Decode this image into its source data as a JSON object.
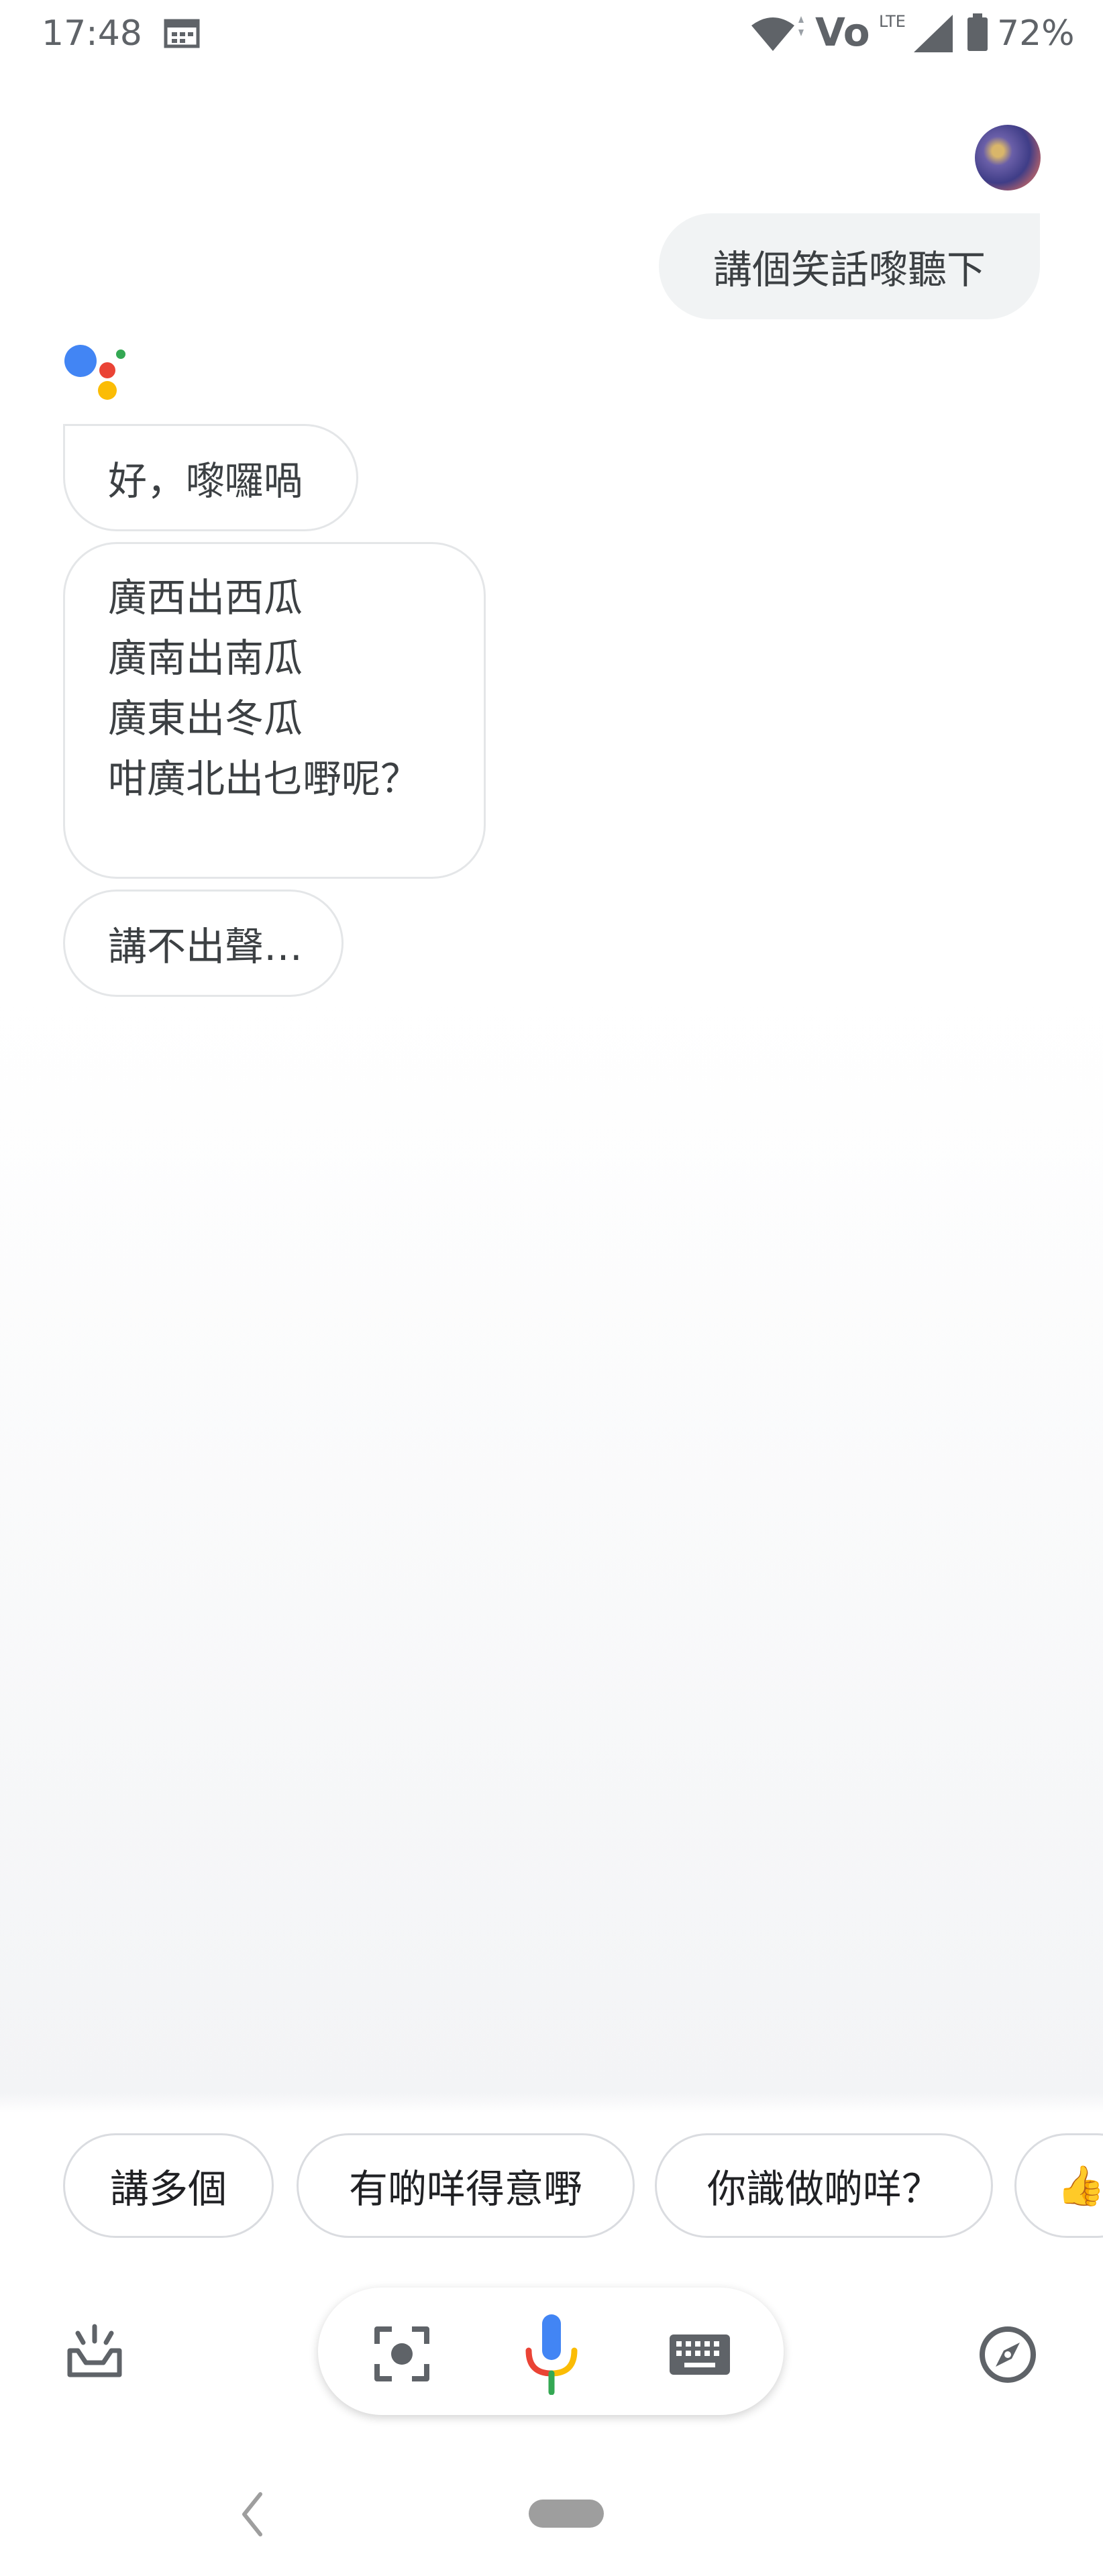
{
  "status_bar": {
    "time": "17:48",
    "volte": "Vo",
    "lte": "LTE",
    "battery_percent": "72%",
    "icons": [
      "calendar-icon",
      "wifi-icon",
      "volte-icon",
      "signal-icon",
      "battery-icon"
    ]
  },
  "conversation": {
    "user_query": "講個笑話嚟聽下",
    "assistant_reply": "好，嚟囉喎",
    "joke_lines": [
      "廣西出西瓜",
      "廣南出南瓜",
      "廣東出冬瓜",
      "咁廣北出乜嘢呢？"
    ],
    "punchline": "講不出聲…"
  },
  "suggestions": [
    "講多個",
    "有啲咩得意嘢",
    "你識做啲咩？",
    "👍"
  ],
  "bottom_bar": {
    "icons": [
      "updates-icon",
      "lens-icon",
      "mic-icon",
      "keyboard-icon",
      "explore-icon"
    ]
  },
  "colors": {
    "google_blue": "#4285f4",
    "google_red": "#ea4335",
    "google_yellow": "#fbbc05",
    "google_green": "#34a853",
    "bubble_gray": "#f1f3f4",
    "icon_gray": "#5f6368"
  }
}
